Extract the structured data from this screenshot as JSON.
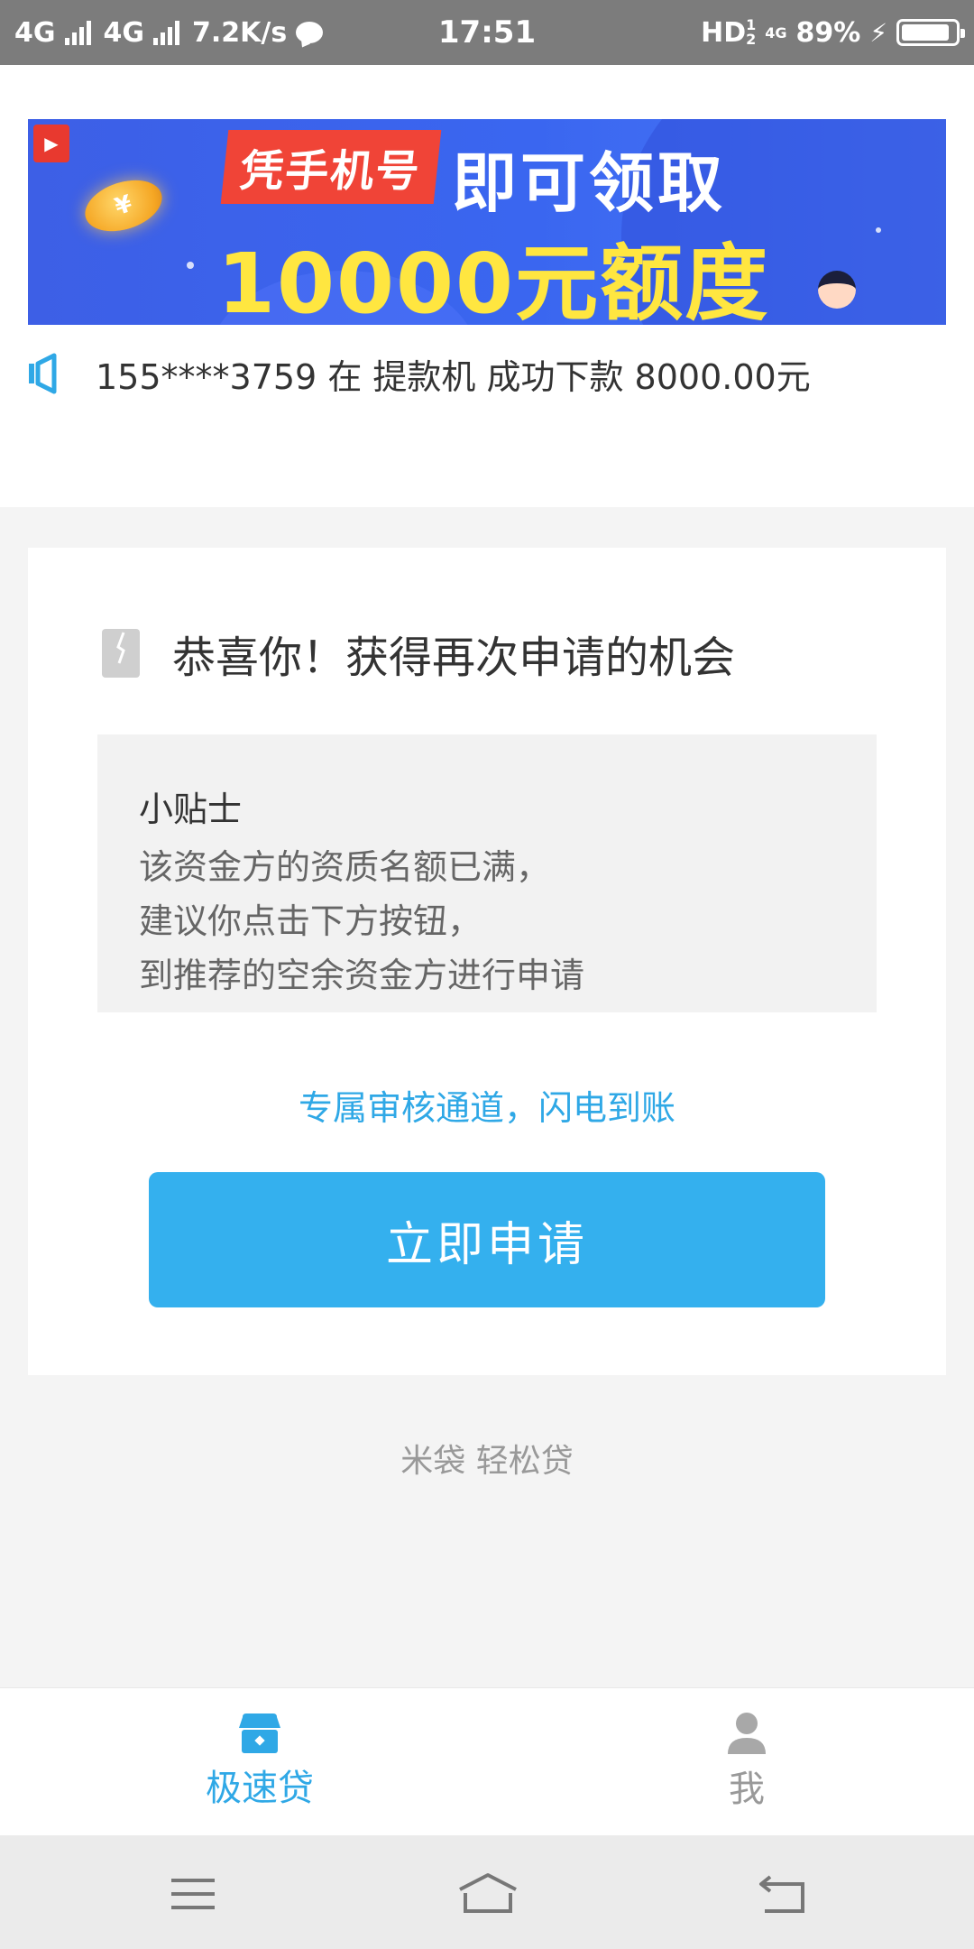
{
  "status_bar": {
    "network1": "4G",
    "network2": "4G",
    "speed": "7.2K/s",
    "time": "17:51",
    "hd": "HD",
    "hd_sup": "1",
    "hd_sub": "2",
    "net_small": "4G",
    "battery": "89%",
    "battery_level": 0.89
  },
  "banner": {
    "tag": "凭手机号",
    "line1": "即可领取",
    "line2": "10000元额度",
    "coin_symbol": "¥"
  },
  "notice": {
    "text": "155****3759 在 提款机 成功下款 8000.00元"
  },
  "card": {
    "title": "恭喜你！获得再次申请的机会",
    "tips_title": "小贴士",
    "tips_lines": [
      "该资金方的资质名额已满，",
      "建议你点击下方按钮，",
      "到推荐的空余资金方进行申请"
    ],
    "subtitle": "专属审核通道，闪电到账",
    "apply_label": "立即申请"
  },
  "footer": {
    "brand": "米袋 轻松贷"
  },
  "tabs": [
    {
      "label": "极速贷",
      "icon": "shop-icon",
      "active": true
    },
    {
      "label": "我",
      "icon": "person-icon",
      "active": false
    }
  ],
  "colors": {
    "accent": "#34b0ee",
    "accent_text": "#2fa8e6",
    "banner_bg": "#3a66f0",
    "banner_yellow": "#ffe640",
    "banner_tag": "#f04437",
    "status_bar": "#7c7c7c"
  }
}
